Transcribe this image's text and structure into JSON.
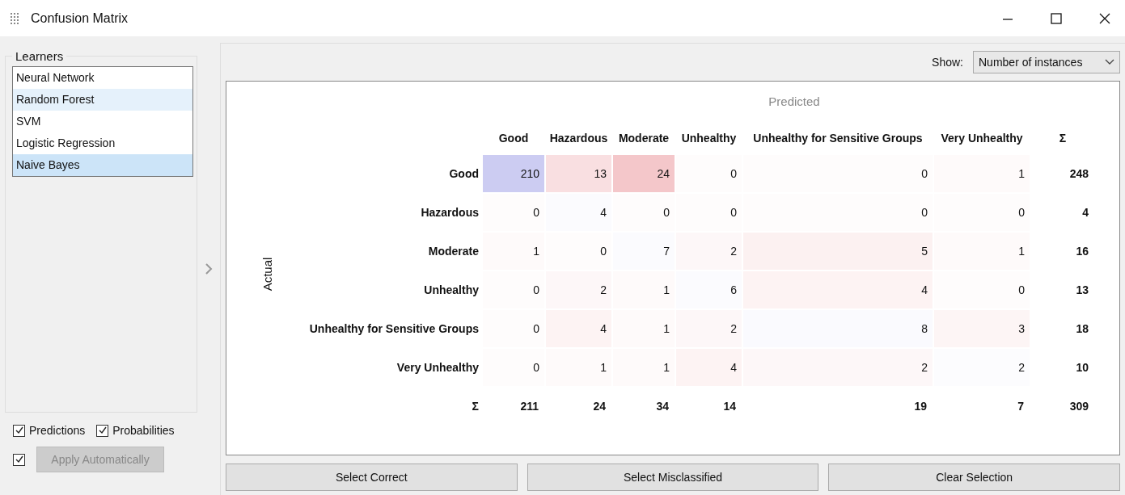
{
  "window": {
    "title": "Confusion Matrix"
  },
  "learners": {
    "title": "Learners",
    "items": [
      {
        "label": "Neural Network",
        "selected": false,
        "hovered": false
      },
      {
        "label": "Random Forest",
        "selected": false,
        "hovered": true
      },
      {
        "label": "SVM",
        "selected": false,
        "hovered": false
      },
      {
        "label": "Logistic Regression",
        "selected": false,
        "hovered": false
      },
      {
        "label": "Naive Bayes",
        "selected": true,
        "hovered": false
      }
    ]
  },
  "options": [
    {
      "label": "Predictions",
      "checked": true
    },
    {
      "label": "Probabilities",
      "checked": true
    }
  ],
  "apply": {
    "checked": true,
    "label": "Apply Automatically",
    "disabled": true
  },
  "show": {
    "label": "Show:",
    "value": "Number of instances"
  },
  "matrix": {
    "predicted_label": "Predicted",
    "actual_label": "Actual",
    "sum_header": "Σ",
    "sum_row_label": "Σ",
    "columns": [
      "Good",
      "Hazardous",
      "Moderate",
      "Unhealthy",
      "Unhealthy for Sensitive Groups",
      "Very Unhealthy"
    ],
    "rows": [
      {
        "label": "Good",
        "values": [
          "210",
          "13",
          "24",
          "0",
          "0",
          "1"
        ],
        "sum": "248"
      },
      {
        "label": "Hazardous",
        "values": [
          "0",
          "4",
          "0",
          "0",
          "0",
          "0"
        ],
        "sum": "4"
      },
      {
        "label": "Moderate",
        "values": [
          "1",
          "0",
          "7",
          "2",
          "5",
          "1"
        ],
        "sum": "16"
      },
      {
        "label": "Unhealthy",
        "values": [
          "0",
          "2",
          "1",
          "6",
          "4",
          "0"
        ],
        "sum": "13"
      },
      {
        "label": "Unhealthy for Sensitive Groups",
        "values": [
          "0",
          "4",
          "1",
          "2",
          "8",
          "3"
        ],
        "sum": "18"
      },
      {
        "label": "Very Unhealthy",
        "values": [
          "0",
          "1",
          "1",
          "4",
          "2",
          "2"
        ],
        "sum": "10"
      }
    ],
    "column_sums": [
      "211",
      "24",
      "34",
      "14",
      "19",
      "7"
    ],
    "total": "309"
  },
  "buttons": [
    "Select Correct",
    "Select Misclassified",
    "Clear Selection"
  ]
}
